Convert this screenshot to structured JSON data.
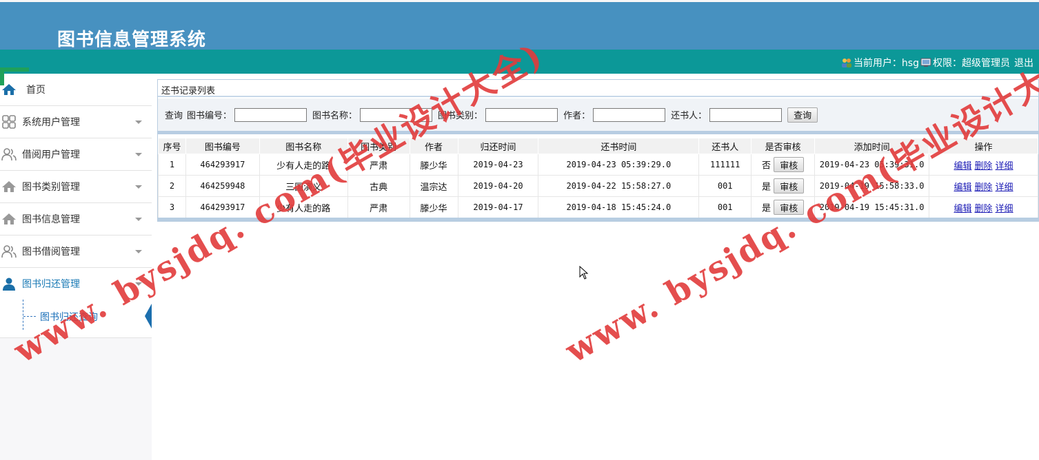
{
  "app": {
    "title": "图书信息管理系统"
  },
  "userbar": {
    "user_label": "当前用户：hsg",
    "role_label": "权限：超级管理员",
    "logout": "退出"
  },
  "sidebar": {
    "items": [
      {
        "label": "首页",
        "icon": "home-icon"
      },
      {
        "label": "系统用户管理",
        "icon": "grid-icon"
      },
      {
        "label": "借阅用户管理",
        "icon": "users-icon"
      },
      {
        "label": "图书类别管理",
        "icon": "home-icon"
      },
      {
        "label": "图书信息管理",
        "icon": "home-icon"
      },
      {
        "label": "图书借阅管理",
        "icon": "users-icon"
      },
      {
        "label": "图书归还管理",
        "icon": "user-icon"
      }
    ],
    "subitem": "图书归还查询"
  },
  "panel": {
    "title": "还书记录列表"
  },
  "search": {
    "query_label": "查询",
    "book_no_label": "图书编号：",
    "book_name_label": "图书名称：",
    "book_type_label": "图书类别：",
    "author_label": "作者：",
    "returner_label": "还书人：",
    "button": "查询"
  },
  "table": {
    "headers": [
      "序号",
      "图书编号",
      "图书名称",
      "图书类别",
      "作者",
      "归还时间",
      "还书时间",
      "还书人",
      "是否审核",
      "添加时间",
      "操作"
    ],
    "audit_button": "审核",
    "actions": [
      "编辑",
      "删除",
      "详细"
    ],
    "rows": [
      [
        "1",
        "464293917",
        "少有人走的路",
        "严肃",
        "滕少华",
        "2019-04-23",
        "2019-04-23 05:39:29.0",
        "111111",
        "否",
        "2019-04-23 05:39:31.0"
      ],
      [
        "2",
        "464259948",
        "三国演义",
        "古典",
        "温宗达",
        "2019-04-20",
        "2019-04-22 15:58:27.0",
        "001",
        "是",
        "2019-04-19 15:58:33.0"
      ],
      [
        "3",
        "464293917",
        "少有人走的路",
        "严肃",
        "滕少华",
        "2019-04-17",
        "2019-04-18 15:45:24.0",
        "001",
        "是",
        "2019-04-19 15:45:31.0"
      ]
    ]
  },
  "watermark": {
    "text": "www. bysjdq. com(毕业设计大全)"
  }
}
